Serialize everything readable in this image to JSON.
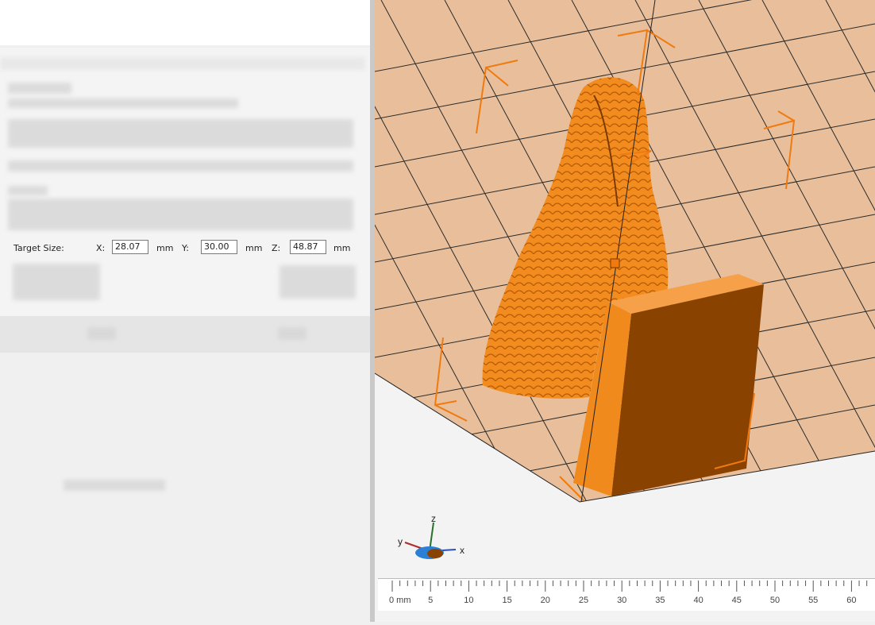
{
  "scale_panel": {
    "target_size_label": "Target Size:",
    "x_label": "X:",
    "x_value": "28.07",
    "y_label": "Y:",
    "y_value": "30.00",
    "z_label": "Z:",
    "z_value": "48.87",
    "unit": "mm"
  },
  "axis_gizmo": {
    "z": "z",
    "y": "y",
    "x": "x"
  },
  "ruler": {
    "ticks": [
      "0 mm",
      "5",
      "10",
      "15",
      "20",
      "25",
      "30",
      "35",
      "40",
      "45",
      "50",
      "55",
      "60"
    ]
  },
  "colors": {
    "model": "#f08a1c",
    "bed": "#e8bf9a",
    "grid": "#2a2a2a",
    "selection": "#f07a10"
  }
}
